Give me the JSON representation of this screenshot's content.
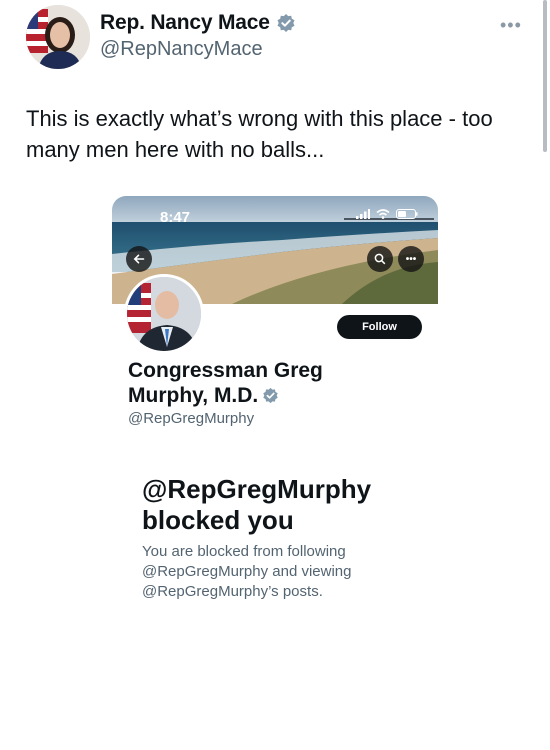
{
  "tweet": {
    "author_name": "Rep. Nancy Mace",
    "author_handle": "@RepNancyMace",
    "more_icon": "more-horizontal-icon",
    "text": "This is exactly what’s wrong with this place - too many men here with no balls..."
  },
  "embedded_profile": {
    "status_time": "8:47",
    "follow_label": "Follow",
    "display_name": "Congressman Greg Murphy, M.D.",
    "handle": "@RepGregMurphy",
    "blocked_title": "@RepGregMurphy blocked you",
    "blocked_description": "You are blocked from following @RepGregMurphy and viewing @RepGregMurphy’s posts."
  },
  "colors": {
    "verified_badge": "#829aab",
    "text_primary": "#0f1419",
    "text_secondary": "#536471"
  }
}
